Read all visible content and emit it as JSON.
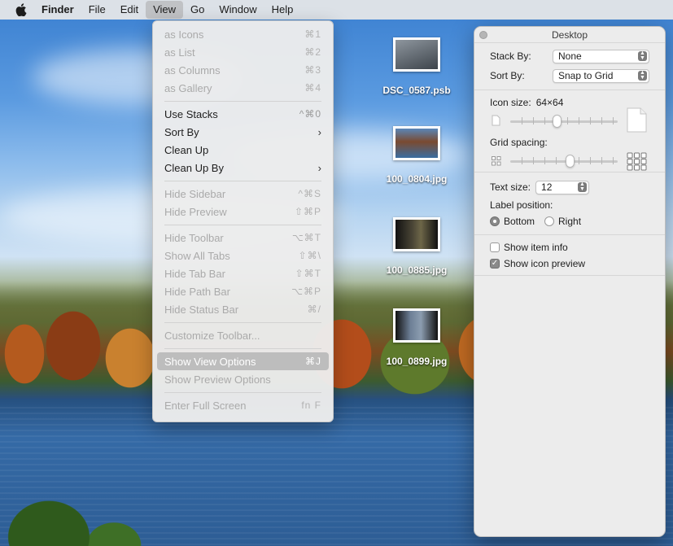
{
  "menubar": {
    "items": [
      "Finder",
      "File",
      "Edit",
      "View",
      "Go",
      "Window",
      "Help"
    ],
    "active": "View"
  },
  "view_menu": {
    "groups": [
      [
        {
          "label": "as Icons",
          "shortcut": "⌘1",
          "enabled": false
        },
        {
          "label": "as List",
          "shortcut": "⌘2",
          "enabled": false
        },
        {
          "label": "as Columns",
          "shortcut": "⌘3",
          "enabled": false
        },
        {
          "label": "as Gallery",
          "shortcut": "⌘4",
          "enabled": false
        }
      ],
      [
        {
          "label": "Use Stacks",
          "shortcut": "^⌘0",
          "enabled": true
        },
        {
          "label": "Sort By",
          "submenu": true,
          "enabled": true
        },
        {
          "label": "Clean Up",
          "shortcut": "",
          "enabled": true
        },
        {
          "label": "Clean Up By",
          "submenu": true,
          "enabled": true
        }
      ],
      [
        {
          "label": "Hide Sidebar",
          "shortcut": "^⌘S",
          "enabled": false
        },
        {
          "label": "Hide Preview",
          "shortcut": "⇧⌘P",
          "enabled": false
        }
      ],
      [
        {
          "label": "Hide Toolbar",
          "shortcut": "⌥⌘T",
          "enabled": false
        },
        {
          "label": "Show All Tabs",
          "shortcut": "⇧⌘\\",
          "enabled": false
        },
        {
          "label": "Hide Tab Bar",
          "shortcut": "⇧⌘T",
          "enabled": false
        },
        {
          "label": "Hide Path Bar",
          "shortcut": "⌥⌘P",
          "enabled": false
        },
        {
          "label": "Hide Status Bar",
          "shortcut": "⌘/",
          "enabled": false
        }
      ],
      [
        {
          "label": "Customize Toolbar...",
          "shortcut": "",
          "enabled": false
        }
      ],
      [
        {
          "label": "Show View Options",
          "shortcut": "⌘J",
          "enabled": true,
          "highlighted": true
        },
        {
          "label": "Show Preview Options",
          "shortcut": "",
          "enabled": false
        }
      ],
      [
        {
          "label": "Enter Full Screen",
          "shortcut": "fn F",
          "enabled": false
        }
      ]
    ]
  },
  "files": [
    {
      "name": "DSC_0587.psb",
      "color": "#5d6670"
    },
    {
      "name": "100_0804.jpg",
      "color": "#6b4a36"
    },
    {
      "name": "100_0885.jpg",
      "color": "#3a3528"
    },
    {
      "name": "100_0899.jpg",
      "color": "#4e5a6a"
    }
  ],
  "options": {
    "title": "Desktop",
    "stack_by_label": "Stack By:",
    "stack_by_value": "None",
    "sort_by_label": "Sort By:",
    "sort_by_value": "Snap to Grid",
    "icon_size_label": "Icon size:",
    "icon_size_value": "64×64",
    "icon_size_level": 0.43,
    "grid_spacing_label": "Grid spacing:",
    "grid_spacing_level": 0.55,
    "text_size_label": "Text size:",
    "text_size_value": "12",
    "label_position_label": "Label position:",
    "label_bottom": "Bottom",
    "label_right": "Right",
    "label_position_selected": "Bottom",
    "show_item_info_label": "Show item info",
    "show_item_info": false,
    "show_icon_preview_label": "Show icon preview",
    "show_icon_preview": true
  }
}
